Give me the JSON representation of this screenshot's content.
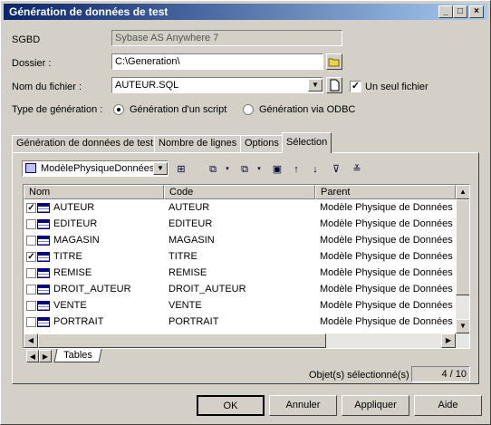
{
  "window": {
    "title": "Génération de données de test",
    "min": "_",
    "max": "□",
    "close": "×"
  },
  "form": {
    "sgbd_label": "SGBD",
    "sgbd_value": "Sybase AS Anywhere 7",
    "dossier_label": "Dossier :",
    "dossier_value": "C:\\Generation\\",
    "fichier_label": "Nom du fichier :",
    "fichier_value": "AUTEUR.SQL",
    "un_seul_fichier_label": "Un seul fichier",
    "un_seul_fichier_checked": true,
    "type_label": "Type de génération :",
    "type_options": [
      "Génération d'un script",
      "Génération via ODBC"
    ],
    "type_selected": "Génération d'un script"
  },
  "tabs": [
    "Génération de données de test",
    "Nombre de lignes",
    "Options",
    "Sélection"
  ],
  "active_tab": "Sélection",
  "toolbar": {
    "model_select": "ModèlePhysiqueDonnées"
  },
  "grid": {
    "columns": [
      "Nom",
      "Code",
      "Parent"
    ],
    "rows": [
      {
        "checked": true,
        "nom": "AUTEUR",
        "code": "AUTEUR",
        "parent": "Modèle Physique de Données 'M"
      },
      {
        "checked": false,
        "nom": "EDITEUR",
        "code": "EDITEUR",
        "parent": "Modèle Physique de Données 'M"
      },
      {
        "checked": false,
        "nom": "MAGASIN",
        "code": "MAGASIN",
        "parent": "Modèle Physique de Données 'M"
      },
      {
        "checked": true,
        "nom": "TITRE",
        "code": "TITRE",
        "parent": "Modèle Physique de Données 'M"
      },
      {
        "checked": false,
        "nom": "REMISE",
        "code": "REMISE",
        "parent": "Modèle Physique de Données 'M"
      },
      {
        "checked": false,
        "nom": "DROIT_AUTEUR",
        "code": "DROIT_AUTEUR",
        "parent": "Modèle Physique de Données 'M"
      },
      {
        "checked": false,
        "nom": "VENTE",
        "code": "VENTE",
        "parent": "Modèle Physique de Données 'M"
      },
      {
        "checked": false,
        "nom": "PORTRAIT",
        "code": "PORTRAIT",
        "parent": "Modèle Physique de Données 'M"
      }
    ]
  },
  "sheet_tab": "Tables",
  "status": {
    "label": "Objet(s) sélectionné(s) :",
    "value": "4 / 10"
  },
  "buttons": {
    "ok": "OK",
    "annuler": "Annuler",
    "appliquer": "Appliquer",
    "aide": "Aide"
  }
}
